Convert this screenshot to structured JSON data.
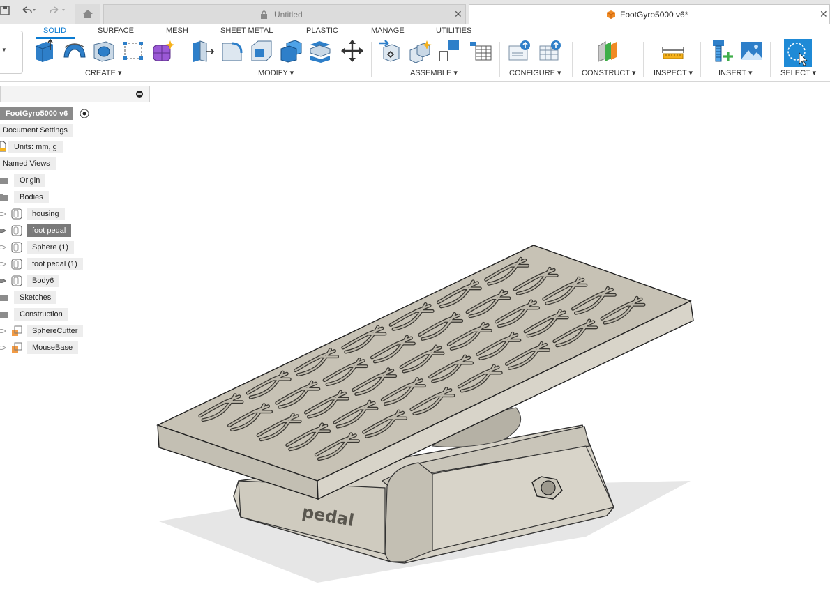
{
  "tabs": {
    "untitled": "Untitled",
    "active": "FootGyro5000 v6*"
  },
  "ribbon": {
    "tabs": [
      "SOLID",
      "SURFACE",
      "MESH",
      "SHEET METAL",
      "PLASTIC",
      "MANAGE",
      "UTILITIES"
    ],
    "groups": [
      "CREATE ▾",
      "MODIFY ▾",
      "ASSEMBLE ▾",
      "CONFIGURE ▾",
      "CONSTRUCT ▾",
      "INSPECT ▾",
      "INSERT ▾",
      "SELECT ▾"
    ]
  },
  "browser": {
    "root": "FootGyro5000 v6",
    "document_settings": "Document Settings",
    "units": "Units: mm, g",
    "named_views": "Named Views",
    "origin": "Origin",
    "bodies": "Bodies",
    "body_items": [
      "housing",
      "foot pedal",
      "Sphere (1)",
      "foot pedal (1)",
      "Body6"
    ],
    "sketches": "Sketches",
    "construction": "Construction",
    "construction_items": [
      "SphereCutter",
      "MouseBase"
    ]
  },
  "model": {
    "engraved_text": "pedal"
  },
  "icons": [
    "save-icon",
    "undo-icon",
    "redo-icon",
    "home-icon",
    "lock-icon",
    "box-icon",
    "close-icon",
    "eye-icon",
    "body-icon",
    "folder-icon",
    "radio-icon",
    "doc-icon"
  ]
}
